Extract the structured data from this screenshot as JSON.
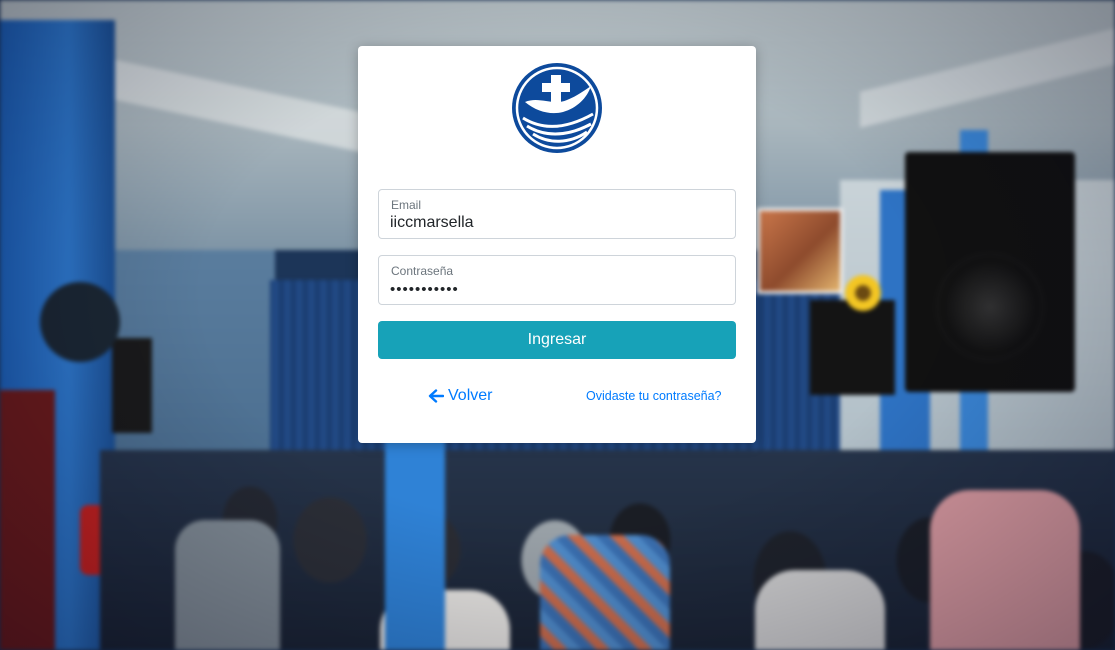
{
  "colors": {
    "primary_button": "#17a2b8",
    "link": "#007bff",
    "logo_blue": "#0d4a9c",
    "card_background": "#ffffff"
  },
  "logo": {
    "icon": "church-cross-dove-logo-icon"
  },
  "login": {
    "email": {
      "label": "Email",
      "value": "iiccmarsella"
    },
    "password": {
      "label": "Contraseña",
      "value": "•••••••••••"
    },
    "submit_label": "Ingresar",
    "back_label": "Volver",
    "back_icon": "arrow-left-icon",
    "forgot_label": "Ovidaste tu contraseña?"
  },
  "background": {
    "description_icon": "church-congregation-background-image"
  }
}
